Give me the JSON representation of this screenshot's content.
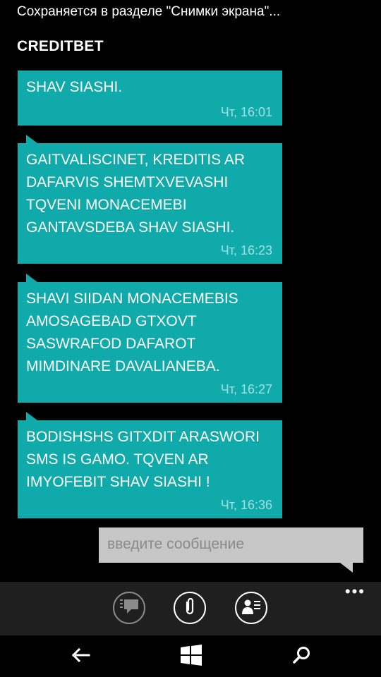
{
  "status_bar": {
    "text": "Сохраняется в разделе \"Снимки экрана\"..."
  },
  "conversation": {
    "title": "CREDITBET"
  },
  "messages": [
    {
      "text": "SHAV SIASHI.",
      "time": "Чт, 16:01"
    },
    {
      "text": "GAITVALISCINET, KREDITIS AR DAFARVIS SHEMTXVEVASHI TQVENI MONACEMEBI GANTAVSDEBA SHAV SIASHI.",
      "time": "Чт, 16:23"
    },
    {
      "text": "SHAVI SIIDAN MONACEMEBIS AMOSAGEBAD GTXOVT SASWRAFOD DAFAROT MIMDINARE DAVALIANEBA.",
      "time": "Чт, 16:27"
    },
    {
      "text": "BODISHSHS GITXDIT ARASWORI SMS IS GAMO. TQVEN AR IMYOFEBIT SHAV SIASHI !",
      "time": "Чт, 16:36"
    }
  ],
  "composer": {
    "placeholder": "введите сообщение",
    "value": ""
  },
  "colors": {
    "bubble": "#10AAAA",
    "background": "#000000",
    "input": "#C7C7C7",
    "app_bar": "#1F1F1F"
  },
  "app_bar": {
    "icons": [
      "chat-icon",
      "attach-icon",
      "contact-card-icon"
    ],
    "more": "•••"
  },
  "nav_bar": {
    "icons": [
      "back-arrow-icon",
      "windows-start-icon",
      "search-icon"
    ]
  }
}
